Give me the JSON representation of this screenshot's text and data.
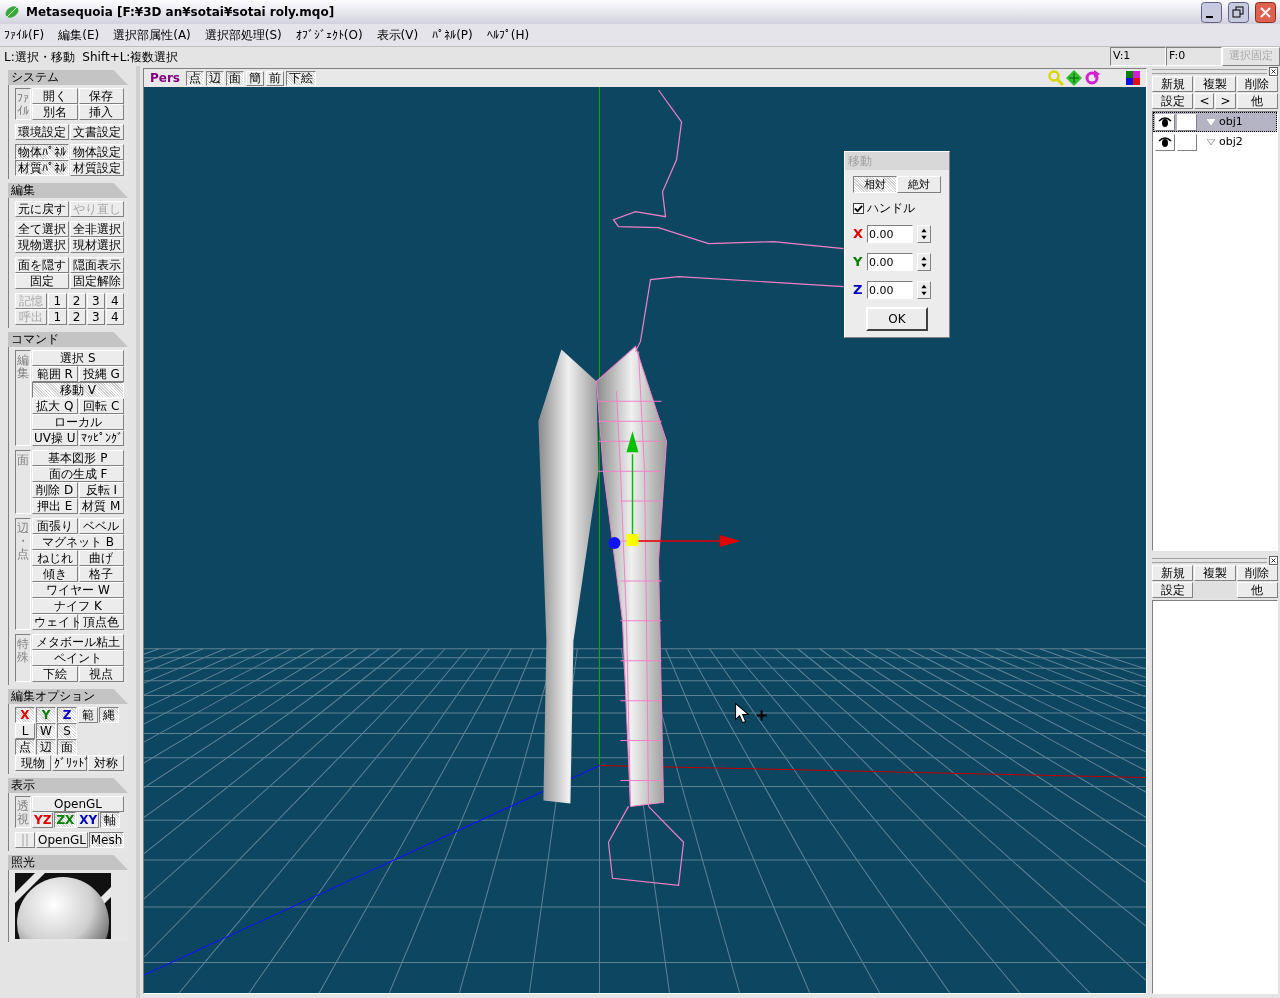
{
  "window": {
    "title": "Metasequoia [F:¥3D an¥sotai¥sotai roly.mqo]"
  },
  "menu": [
    "ﾌｧｲﾙ(F)",
    "編集(E)",
    "選択部属性(A)",
    "選択部処理(S)",
    "ｵﾌﾞｼﾞｪｸﾄ(O)",
    "表示(V)",
    "ﾊﾟﾈﾙ(P)",
    "ﾍﾙﾌﾟ(H)"
  ],
  "status_bar": {
    "hint": "L:選択・移動  Shift+L:複数選択",
    "vertices": "V:1",
    "faces": "F:0",
    "lock_button": {
      "label": "選択固定",
      "disabled": true
    }
  },
  "sections": [
    {
      "title": "システム",
      "kind": "buttons",
      "groups": [
        {
          "side_label": "ﾌｧｲﾙ",
          "rows": [
            {
              "kind": "fill",
              "buttons": [
                {
                  "label": "開く",
                  "selected": false,
                  "disabled": false
                },
                {
                  "label": "保存",
                  "selected": false,
                  "disabled": false
                }
              ]
            },
            {
              "kind": "fill",
              "buttons": [
                {
                  "label": "別名",
                  "selected": false,
                  "disabled": false
                },
                {
                  "label": "挿入",
                  "selected": false,
                  "disabled": false
                }
              ]
            }
          ]
        },
        {
          "rows": [
            {
              "kind": "fill",
              "buttons": [
                {
                  "label": "環境設定",
                  "selected": false,
                  "disabled": false
                },
                {
                  "label": "文書設定",
                  "selected": false,
                  "disabled": false
                }
              ]
            }
          ]
        },
        {
          "rows": [
            {
              "kind": "fill",
              "buttons": [
                {
                  "label": "物体ﾊﾟﾈﾙ",
                  "selected": true,
                  "disabled": false
                },
                {
                  "label": "物体設定",
                  "selected": false,
                  "disabled": false
                }
              ]
            },
            {
              "kind": "fill",
              "buttons": [
                {
                  "label": "材質ﾊﾟﾈﾙ",
                  "selected": true,
                  "disabled": false
                },
                {
                  "label": "材質設定",
                  "selected": false,
                  "disabled": false
                }
              ]
            }
          ]
        }
      ]
    },
    {
      "title": "編集",
      "kind": "buttons",
      "groups": [
        {
          "rows": [
            {
              "kind": "fill",
              "buttons": [
                {
                  "label": "元に戻す",
                  "selected": false,
                  "disabled": false
                },
                {
                  "label": "やり直し",
                  "selected": false,
                  "disabled": true
                }
              ]
            }
          ]
        },
        {
          "rows": [
            {
              "kind": "fill",
              "buttons": [
                {
                  "label": "全て選択",
                  "selected": false,
                  "disabled": false
                },
                {
                  "label": "全非選択",
                  "selected": false,
                  "disabled": false
                }
              ]
            },
            {
              "kind": "fill",
              "buttons": [
                {
                  "label": "現物選択",
                  "selected": false,
                  "disabled": false
                },
                {
                  "label": "現材選択",
                  "selected": false,
                  "disabled": false
                }
              ]
            }
          ]
        },
        {
          "rows": [
            {
              "kind": "fill",
              "buttons": [
                {
                  "label": "面を隠す",
                  "selected": false,
                  "disabled": false
                },
                {
                  "label": "隠面表示",
                  "selected": false,
                  "disabled": false
                }
              ]
            },
            {
              "kind": "fill",
              "buttons": [
                {
                  "label": "固定",
                  "selected": false,
                  "disabled": false
                },
                {
                  "label": "固定解除",
                  "selected": false,
                  "disabled": false
                }
              ]
            }
          ]
        },
        {
          "rows": [
            {
              "kind": "memory",
              "buttons": [
                {
                  "label": "記憶",
                  "selected": false,
                  "disabled": true
                },
                {
                  "label": "1",
                  "selected": false,
                  "disabled": false
                },
                {
                  "label": "2",
                  "selected": false,
                  "disabled": false
                },
                {
                  "label": "3",
                  "selected": false,
                  "disabled": false
                },
                {
                  "label": "4",
                  "selected": false,
                  "disabled": false
                }
              ]
            },
            {
              "kind": "memory",
              "buttons": [
                {
                  "label": "呼出",
                  "selected": false,
                  "disabled": true
                },
                {
                  "label": "1",
                  "selected": false,
                  "disabled": false
                },
                {
                  "label": "2",
                  "selected": false,
                  "disabled": false
                },
                {
                  "label": "3",
                  "selected": false,
                  "disabled": false
                },
                {
                  "label": "4",
                  "selected": false,
                  "disabled": false
                }
              ]
            }
          ]
        }
      ]
    },
    {
      "title": "コマンド",
      "kind": "buttons",
      "groups": [
        {
          "side_label": "編集",
          "rows": [
            {
              "kind": "fill",
              "buttons": [
                {
                  "label": "選択 S",
                  "selected": false,
                  "disabled": false
                }
              ]
            },
            {
              "kind": "fill",
              "buttons": [
                {
                  "label": "範囲 R",
                  "selected": false,
                  "disabled": false
                },
                {
                  "label": "投縄 G",
                  "selected": false,
                  "disabled": false
                }
              ]
            },
            {
              "kind": "fill",
              "buttons": [
                {
                  "label": "移動 V",
                  "selected": true,
                  "disabled": false
                }
              ]
            },
            {
              "kind": "fill",
              "buttons": [
                {
                  "label": "拡大 Q",
                  "selected": false,
                  "disabled": false
                },
                {
                  "label": "回転 C",
                  "selected": false,
                  "disabled": false
                }
              ]
            },
            {
              "kind": "fill",
              "buttons": [
                {
                  "label": "ローカル",
                  "selected": false,
                  "disabled": false
                }
              ]
            },
            {
              "kind": "fill",
              "buttons": [
                {
                  "label": "UV操 U",
                  "selected": false,
                  "disabled": false
                },
                {
                  "label": "ﾏｯﾋﾟﾝｸﾞ",
                  "selected": false,
                  "disabled": false
                }
              ]
            }
          ]
        },
        {
          "side_label": "面",
          "rows": [
            {
              "kind": "fill",
              "buttons": [
                {
                  "label": "基本図形 P",
                  "selected": false,
                  "disabled": false
                }
              ]
            },
            {
              "kind": "fill",
              "buttons": [
                {
                  "label": "面の生成 F",
                  "selected": false,
                  "disabled": false
                }
              ]
            },
            {
              "kind": "fill",
              "buttons": [
                {
                  "label": "削除 D",
                  "selected": false,
                  "disabled": false
                },
                {
                  "label": "反転 I",
                  "selected": false,
                  "disabled": false
                }
              ]
            },
            {
              "kind": "fill",
              "buttons": [
                {
                  "label": "押出 E",
                  "selected": false,
                  "disabled": false
                },
                {
                  "label": "材質 M",
                  "selected": false,
                  "disabled": false
                }
              ]
            }
          ]
        },
        {
          "side_label": "辺・点",
          "rows": [
            {
              "kind": "fill",
              "buttons": [
                {
                  "label": "面張り",
                  "selected": false,
                  "disabled": false
                },
                {
                  "label": "ベベル",
                  "selected": false,
                  "disabled": false
                }
              ]
            },
            {
              "kind": "fill",
              "buttons": [
                {
                  "label": "マグネット B",
                  "selected": false,
                  "disabled": false
                }
              ]
            },
            {
              "kind": "fill",
              "buttons": [
                {
                  "label": "ねじれ",
                  "selected": false,
                  "disabled": false
                },
                {
                  "label": "曲げ",
                  "selected": false,
                  "disabled": false
                }
              ]
            },
            {
              "kind": "fill",
              "buttons": [
                {
                  "label": "傾き",
                  "selected": false,
                  "disabled": false
                },
                {
                  "label": "格子",
                  "selected": false,
                  "disabled": false
                }
              ]
            },
            {
              "kind": "fill",
              "buttons": [
                {
                  "label": "ワイヤー W",
                  "selected": false,
                  "disabled": false
                }
              ]
            },
            {
              "kind": "fill",
              "buttons": [
                {
                  "label": "ナイフ K",
                  "selected": false,
                  "disabled": false
                }
              ]
            },
            {
              "kind": "fill",
              "buttons": [
                {
                  "label": "ウェイト",
                  "selected": false,
                  "disabled": false
                },
                {
                  "label": "頂点色",
                  "selected": false,
                  "disabled": false
                }
              ]
            }
          ]
        },
        {
          "side_label": "特殊",
          "rows": [
            {
              "kind": "fill",
              "buttons": [
                {
                  "label": "メタボール粘土",
                  "selected": false,
                  "disabled": false
                }
              ]
            },
            {
              "kind": "fill",
              "buttons": [
                {
                  "label": "ペイント",
                  "selected": false,
                  "disabled": false
                }
              ]
            },
            {
              "kind": "fill",
              "buttons": [
                {
                  "label": "下絵",
                  "selected": false,
                  "disabled": false
                },
                {
                  "label": "視点",
                  "selected": false,
                  "disabled": false
                }
              ]
            }
          ]
        }
      ]
    },
    {
      "title": "編集オプション",
      "kind": "buttons",
      "groups": [
        {
          "rows": [
            {
              "kind": "squares",
              "buttons": [
                {
                  "label": "X",
                  "selected": true,
                  "disabled": false,
                  "color": "#e00000"
                },
                {
                  "label": "Y",
                  "selected": true,
                  "disabled": false,
                  "color": "#008000"
                },
                {
                  "label": "Z",
                  "selected": true,
                  "disabled": false,
                  "color": "#0000c0"
                },
                {
                  "label": "範",
                  "selected": false,
                  "disabled": false
                },
                {
                  "label": "縄",
                  "selected": true,
                  "disabled": false
                }
              ]
            },
            {
              "kind": "squares",
              "buttons": [
                {
                  "label": "L",
                  "selected": false,
                  "disabled": false
                },
                {
                  "label": "W",
                  "selected": true,
                  "disabled": false
                },
                {
                  "label": "S",
                  "selected": true,
                  "disabled": false
                }
              ]
            },
            {
              "kind": "squares",
              "buttons": [
                {
                  "label": "点",
                  "selected": true,
                  "disabled": false
                },
                {
                  "label": "辺",
                  "selected": true,
                  "disabled": false
                },
                {
                  "label": "面",
                  "selected": true,
                  "disabled": false
                }
              ]
            },
            {
              "kind": "fill",
              "buttons": [
                {
                  "label": "現物",
                  "selected": false,
                  "disabled": false
                },
                {
                  "label": "ｸﾞﾘｯﾄﾞ",
                  "selected": false,
                  "disabled": false
                },
                {
                  "label": "対称",
                  "selected": false,
                  "disabled": false
                }
              ]
            }
          ]
        }
      ]
    },
    {
      "title": "表示",
      "kind": "buttons",
      "groups": [
        {
          "side_label": "透視",
          "rows": [
            {
              "kind": "fill",
              "buttons": [
                {
                  "label": "OpenGL",
                  "selected": false,
                  "disabled": false
                }
              ]
            },
            {
              "kind": "squares",
              "buttons": [
                {
                  "label": "YZ",
                  "selected": false,
                  "disabled": false,
                  "color": "#e00000"
                },
                {
                  "label": "ZX",
                  "selected": true,
                  "disabled": false,
                  "color": "#008000"
                },
                {
                  "label": "XY",
                  "selected": false,
                  "disabled": false,
                  "color": "#0000c0"
                },
                {
                  "label": "軸",
                  "selected": true,
                  "disabled": false
                }
              ]
            }
          ]
        },
        {
          "rows": [
            {
              "kind": "squares",
              "buttons": [
                {
                  "label": "||",
                  "selected": false,
                  "disabled": true
                },
                {
                  "label": "OpenGL",
                  "selected": false,
                  "disabled": false
                },
                {
                  "label": "Mesh",
                  "selected": true,
                  "disabled": false
                }
              ]
            }
          ]
        }
      ]
    },
    {
      "title": "照光",
      "kind": "light"
    }
  ],
  "viewport": {
    "view": "Pers",
    "toggles": [
      {
        "label": "点",
        "selected": true
      },
      {
        "label": "辺",
        "selected": true
      },
      {
        "label": "面",
        "selected": true
      },
      {
        "label": "簡",
        "selected": false
      },
      {
        "label": "前",
        "selected": false
      },
      {
        "label": "下絵",
        "selected": true
      }
    ]
  },
  "dialog": {
    "title": "移動",
    "tabs": [
      {
        "label": "相対",
        "selected": true
      },
      {
        "label": "絶対",
        "selected": false
      }
    ],
    "handle": {
      "label": "ハンドル",
      "checked": true
    },
    "fields": [
      {
        "label": "X",
        "color": "#e00000",
        "value": "0.00"
      },
      {
        "label": "Y",
        "color": "#008000",
        "value": "0.00"
      },
      {
        "label": "Z",
        "color": "#0000c0",
        "value": "0.00"
      }
    ],
    "ok": "OK"
  },
  "objects": {
    "buttons": [
      [
        "新規",
        "複製",
        "削除"
      ],
      [
        "設定",
        "<",
        ">",
        "他"
      ]
    ],
    "items": [
      {
        "name": "obj1",
        "selected": true,
        "visible": true
      },
      {
        "name": "obj2",
        "selected": false,
        "visible": true
      }
    ]
  },
  "materials": {
    "buttons": [
      [
        "新規",
        "複製",
        "削除"
      ],
      [
        "設定",
        "他"
      ]
    ]
  }
}
